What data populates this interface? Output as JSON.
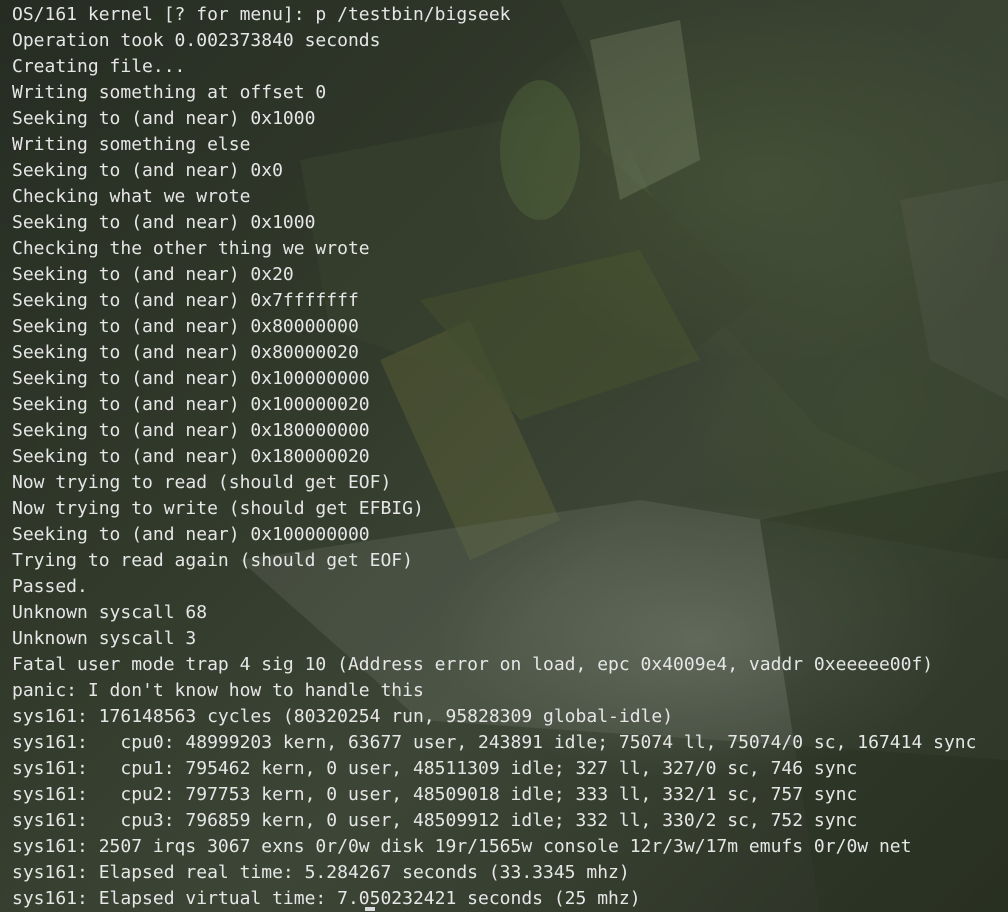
{
  "terminal": {
    "lines": [
      "OS/161 kernel [? for menu]: p /testbin/bigseek",
      "Operation took 0.002373840 seconds",
      "Creating file...",
      "Writing something at offset 0",
      "Seeking to (and near) 0x1000",
      "Writing something else",
      "Seeking to (and near) 0x0",
      "Checking what we wrote",
      "Seeking to (and near) 0x1000",
      "Checking the other thing we wrote",
      "Seeking to (and near) 0x20",
      "Seeking to (and near) 0x7fffffff",
      "Seeking to (and near) 0x80000000",
      "Seeking to (and near) 0x80000020",
      "Seeking to (and near) 0x100000000",
      "Seeking to (and near) 0x100000020",
      "Seeking to (and near) 0x180000000",
      "Seeking to (and near) 0x180000020",
      "Now trying to read (should get EOF)",
      "Now trying to write (should get EFBIG)",
      "Seeking to (and near) 0x100000000",
      "Trying to read again (should get EOF)",
      "Passed.",
      "Unknown syscall 68",
      "Unknown syscall 3",
      "Fatal user mode trap 4 sig 10 (Address error on load, epc 0x4009e4, vaddr 0xeeeee00f)",
      "panic: I don't know how to handle this",
      "sys161: 176148563 cycles (80320254 run, 95828309 global-idle)",
      "sys161:   cpu0: 48999203 kern, 63677 user, 243891 idle; 75074 ll, 75074/0 sc, 167414 sync",
      "sys161:   cpu1: 795462 kern, 0 user, 48511309 idle; 327 ll, 327/0 sc, 746 sync",
      "sys161:   cpu2: 797753 kern, 0 user, 48509018 idle; 333 ll, 332/1 sc, 757 sync",
      "sys161:   cpu3: 796859 kern, 0 user, 48509912 idle; 332 ll, 330/2 sc, 752 sync",
      "sys161: 2507 irqs 3067 exns 0r/0w disk 19r/1565w console 12r/3w/17m emufs 0r/0w net",
      "sys161: Elapsed real time: 5.284267 seconds (33.3345 mhz)",
      "sys161: Elapsed virtual time: 7.050232421 seconds (25 mhz)"
    ]
  },
  "colors": {
    "text": "#e6e6e6",
    "background": "#2b3226",
    "cursor": "#d8d8d8"
  }
}
